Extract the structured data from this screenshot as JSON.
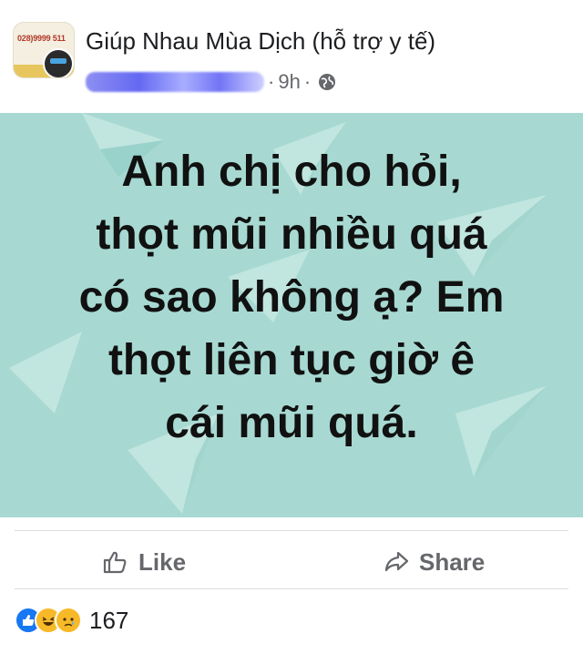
{
  "post": {
    "group_name": "Giúp Nhau Mùa Dịch (hỗ trợ y tế)",
    "avatar_phone_text": "028)9999 511",
    "time": "9h",
    "separator": "·",
    "privacy_icon": "globe-icon",
    "text": "Anh chị cho hỏi,\nthọt mũi nhiều quá\ncó sao không ạ? Em\nthọt liên tục giờ ê\ncái mũi quá.",
    "background_color": "#a7d9d2"
  },
  "actions": {
    "like_label": "Like",
    "share_label": "Share",
    "like_icon": "thumbs-up-icon",
    "share_icon": "share-arrow-icon"
  },
  "reactions": {
    "icons": [
      "like-reaction-icon",
      "haha-reaction-icon",
      "sad-reaction-icon"
    ],
    "count": "167"
  }
}
